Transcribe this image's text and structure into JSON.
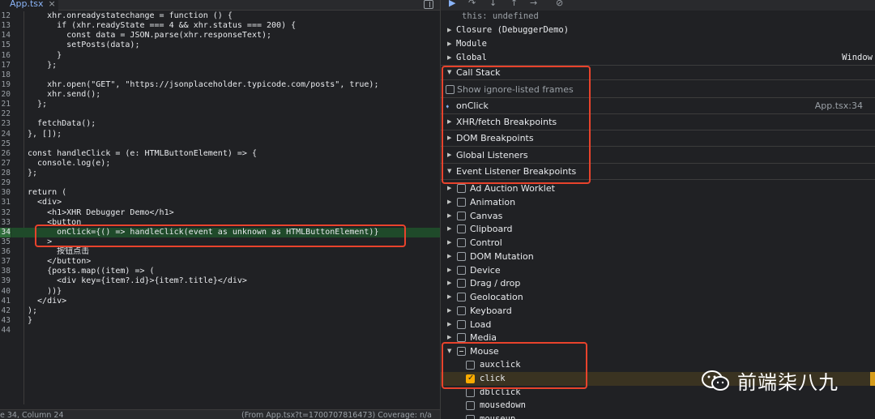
{
  "editor": {
    "file_tab": "App.tsx",
    "close_glyph": "×",
    "lines": [
      {
        "n": "",
        "code": "    xhr.onreadystatechange = function () {"
      },
      {
        "n": "12",
        "code": "    xhr.onreadystatechange = function () {"
      },
      {
        "n": "13",
        "code": "      if (xhr.readyState === 4 && xhr.status === 200) {"
      },
      {
        "n": "14",
        "code": "        const data = JSON.parse(xhr.responseText);"
      },
      {
        "n": "15",
        "code": "        setPosts(data);"
      },
      {
        "n": "16",
        "code": "      }"
      },
      {
        "n": "17",
        "code": "    };"
      },
      {
        "n": "18",
        "code": ""
      },
      {
        "n": "19",
        "code": "    xhr.open(\"GET\", \"https://jsonplaceholder.typicode.com/posts\", true);"
      },
      {
        "n": "20",
        "code": "    xhr.send();"
      },
      {
        "n": "21",
        "code": "  };"
      },
      {
        "n": "22",
        "code": ""
      },
      {
        "n": "23",
        "code": "  fetchData();"
      },
      {
        "n": "24",
        "code": "}, []);"
      },
      {
        "n": "25",
        "code": ""
      },
      {
        "n": "26",
        "code": "const handleClick = (e: HTMLButtonElement) => {"
      },
      {
        "n": "27",
        "code": "  console.log(e);"
      },
      {
        "n": "28",
        "code": "};"
      },
      {
        "n": "29",
        "code": ""
      },
      {
        "n": "30",
        "code": "return ("
      },
      {
        "n": "31",
        "code": "  <div>"
      },
      {
        "n": "32",
        "code": "    <h1>XHR Debugger Demo</h1>"
      },
      {
        "n": "33",
        "code": "    <button"
      },
      {
        "n": "34",
        "code": "      onClick={() => handleClick(event as unknown as HTMLButtonElement)}"
      },
      {
        "n": "35",
        "code": "    >"
      },
      {
        "n": "36",
        "code": "      按钮点击"
      },
      {
        "n": "37",
        "code": "    </button>"
      },
      {
        "n": "38",
        "code": "    {posts.map((item) => ("
      },
      {
        "n": "39",
        "code": "      <div key={item?.id}>{item?.title}</div>"
      },
      {
        "n": "40",
        "code": "    ))}"
      },
      {
        "n": "41",
        "code": "  </div>"
      },
      {
        "n": "42",
        "code": ");"
      },
      {
        "n": "43",
        "code": "}"
      },
      {
        "n": "44",
        "code": ""
      }
    ],
    "status_position": "e 34, Column 24",
    "status_source": "(From App.tsx?t=1700707816473) Coverage: n/a"
  },
  "debugger": {
    "toolbar": [
      "resume-icon",
      "step-over-icon",
      "step-into-icon",
      "step-out-icon",
      "step-icon",
      "deactivate-breakpoints-icon"
    ],
    "scope": {
      "this_line": "this: undefined",
      "closure": "Closure (DebuggerDemo)",
      "module": "Module",
      "global": "Global",
      "global_value": "Window"
    },
    "call_stack": {
      "title": "Call Stack",
      "show_ignored": "Show ignore-listed frames",
      "frame_name": "onClick",
      "frame_location": "App.tsx:34"
    },
    "sections": {
      "xhr": "XHR/fetch Breakpoints",
      "dom": "DOM Breakpoints",
      "global_listeners": "Global Listeners",
      "event_listener": "Event Listener Breakpoints"
    },
    "event_categories": [
      "Ad Auction Worklet",
      "Animation",
      "Canvas",
      "Clipboard",
      "Control",
      "DOM Mutation",
      "Device",
      "Drag / drop",
      "Geolocation",
      "Keyboard",
      "Load",
      "Media"
    ],
    "mouse": {
      "label": "Mouse",
      "events": [
        {
          "name": "auxclick",
          "checked": false
        },
        {
          "name": "click",
          "checked": true
        },
        {
          "name": "dblclick",
          "checked": false
        },
        {
          "name": "mousedown",
          "checked": false
        },
        {
          "name": "mouseup",
          "checked": false
        }
      ]
    },
    "accent_color": "#8ab4f8",
    "annotation_color": "#e8432c",
    "checked_color": "#f9ab00"
  },
  "watermark": {
    "text": "前端柒八九"
  }
}
